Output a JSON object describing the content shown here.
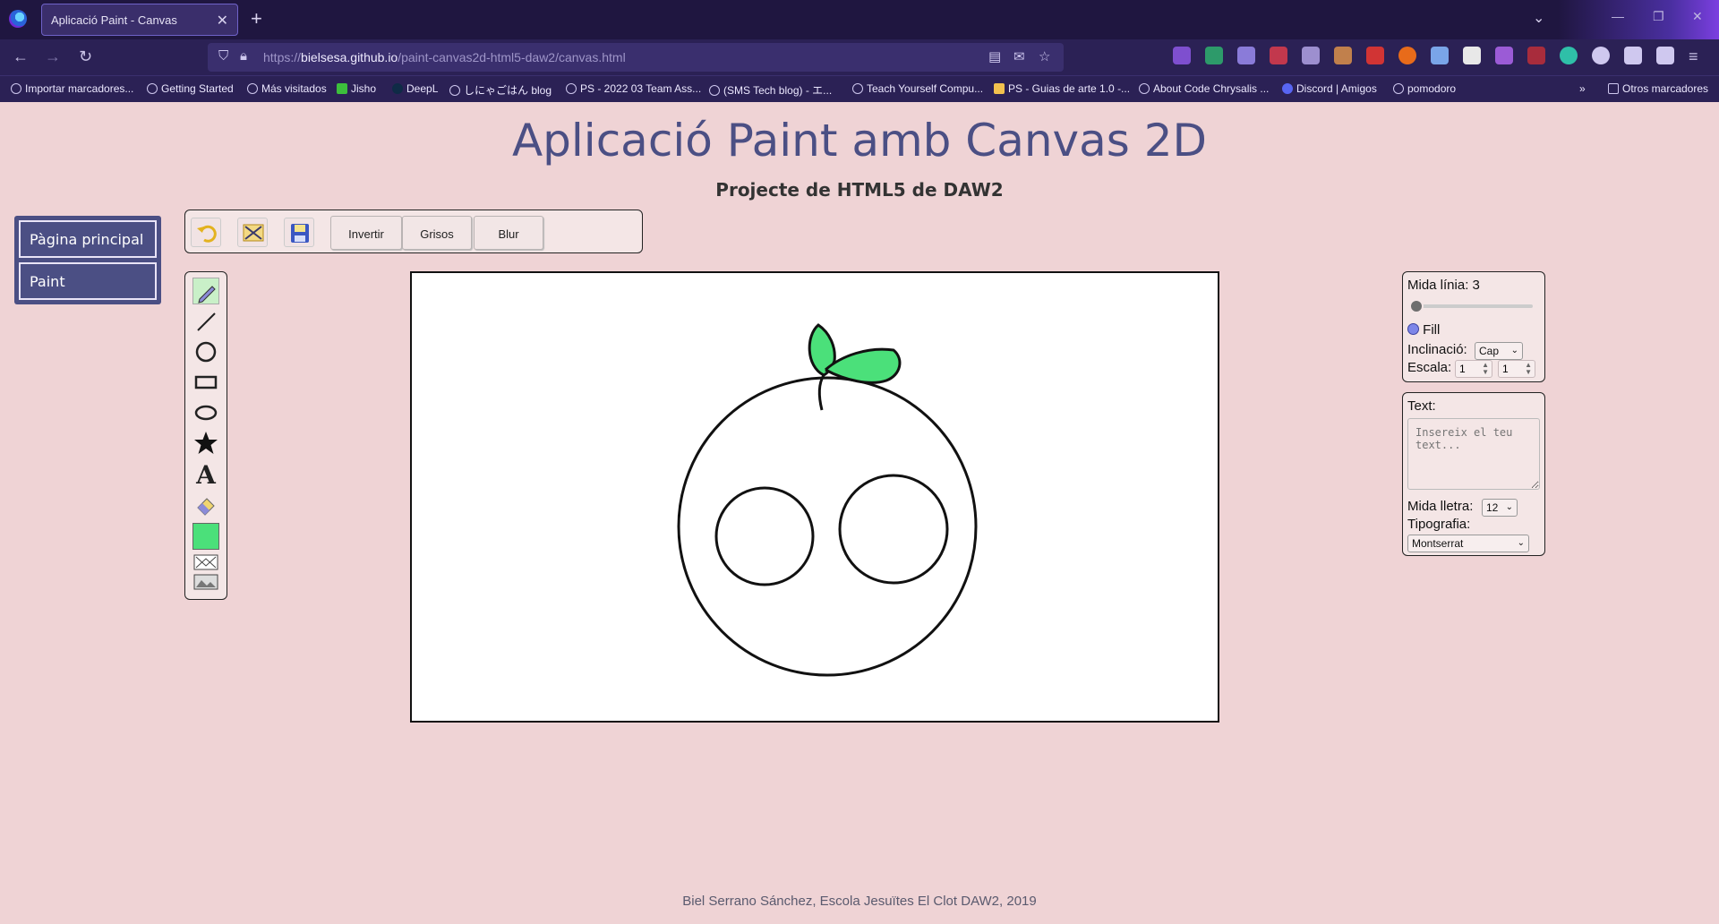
{
  "browser": {
    "tab_title": "Aplicació Paint - Canvas",
    "url_host": "bielsesa.github.io",
    "url_scheme": "https://",
    "url_path": "/paint-canvas2d-html5-daw2/canvas.html",
    "bookmarks": [
      "Importar marcadores...",
      "Getting Started",
      "Más visitados",
      "Jisho",
      "DeepL",
      "しにゃごはん blog",
      "PS - 2022 03 Team Ass...",
      "(SMS Tech blog) - エ...",
      "Teach Yourself Compu...",
      "PS - Guias de arte 1.0 -...",
      "About Code Chrysalis ...",
      "Discord | Amigos",
      "pomodoro"
    ],
    "other_bookmarks": "Otros marcadores"
  },
  "page": {
    "title": "Aplicació Paint amb Canvas 2D",
    "subtitle": "Projecte de HTML5 de DAW2",
    "nav": [
      "Pàgina principal",
      "Paint"
    ],
    "footer": "Biel Serrano Sánchez, Escola Jesuïtes El Clot DAW2, 2019"
  },
  "toolbar": {
    "icons": [
      "undo-icon",
      "clear-icon",
      "save-icon"
    ],
    "buttons": [
      "Invertir",
      "Grisos",
      "Blur"
    ]
  },
  "tools": {
    "items": [
      "pencil-icon",
      "line-icon",
      "circle-icon",
      "rectangle-icon",
      "ellipse-icon",
      "star-icon",
      "text-icon",
      "eraser-icon",
      "color-swatch",
      "filter-icon",
      "image-icon"
    ],
    "active": "pencil-icon",
    "color": "#4be07a"
  },
  "settings": {
    "line_size_label": "Mida línia:",
    "line_size_value": "3",
    "line_size_fraction": 0.03,
    "fill_label": "Fill",
    "tilt_label": "Inclinació:",
    "tilt_value": "Cap",
    "scale_label": "Escala:",
    "scale_x": "1",
    "scale_y": "1"
  },
  "text_panel": {
    "label": "Text:",
    "placeholder": "Insereix el teu text...",
    "font_size_label": "Mida lletra:",
    "font_size_value": "12",
    "font_label": "Tipografia:",
    "font_value": "Montserrat"
  },
  "colors": {
    "page_bg": "#efd3d5",
    "accent": "#4b4f84",
    "leaf_green": "#4be07a"
  }
}
